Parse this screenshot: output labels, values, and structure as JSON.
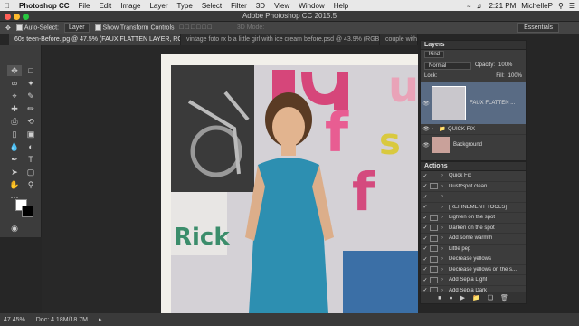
{
  "menubar": {
    "apple": "",
    "app_name": "Photoshop CC",
    "items": [
      "File",
      "Edit",
      "Image",
      "Layer",
      "Type",
      "Select",
      "Filter",
      "3D",
      "View",
      "Window",
      "Help"
    ],
    "time": "2:21 PM",
    "user": "MichelleP"
  },
  "window": {
    "title": "Adobe Photoshop CC 2015.5"
  },
  "options": {
    "auto_select_label": "Auto-Select:",
    "auto_select_value": "Layer",
    "transform_label": "Show Transform Controls",
    "mode_3d": "3D Mode:",
    "workspace": "Essentials"
  },
  "tabs": [
    {
      "label": "60s teen-Before.jpg @ 47.5% (FAUX FLATTEN LAYER, RGB/8#) *"
    },
    {
      "label": "vintage foto rx b a little girl with ice cream before.psd @ 43.9% (RGB/8)"
    },
    {
      "label": "couple with r..."
    }
  ],
  "status": {
    "zoom": "47.45%",
    "doc": "Doc: 4.18M/18.7M"
  },
  "layers_panel": {
    "title": "Layers",
    "kind_filter": "Kind",
    "blend_mode": "Normal",
    "opacity_label": "Opacity:",
    "opacity_value": "100%",
    "lock_label": "Lock:",
    "fill_label": "Fill:",
    "fill_value": "100%",
    "layers": [
      {
        "name": "FAUX FLATTEN ..."
      },
      {
        "name": "QUICK FIX"
      },
      {
        "name": "Background"
      }
    ]
  },
  "actions_panel": {
    "title": "Actions",
    "items": [
      {
        "label": "Quick Fix",
        "checked": true,
        "dialog": false
      },
      {
        "label": "Dust/Spot clean",
        "checked": true,
        "dialog": true
      },
      {
        "label": "",
        "checked": true,
        "dialog": false
      },
      {
        "label": "[REFINEMENT TOOLS]",
        "checked": true,
        "dialog": false
      },
      {
        "label": "Lighten on the spot",
        "checked": true,
        "dialog": true
      },
      {
        "label": "Darken on the spot",
        "checked": true,
        "dialog": true
      },
      {
        "label": "Add some warmth",
        "checked": true,
        "dialog": true
      },
      {
        "label": "Little pep",
        "checked": true,
        "dialog": true
      },
      {
        "label": "Decrease yellows",
        "checked": true,
        "dialog": true
      },
      {
        "label": "Decrease yellows on the s...",
        "checked": true,
        "dialog": true
      },
      {
        "label": "Add Sepia Light",
        "checked": true,
        "dialog": true
      },
      {
        "label": "Add Sepia Dark",
        "checked": true,
        "dialog": true
      }
    ]
  },
  "photo": {
    "wall_letters": [
      "u",
      "f",
      "s",
      "f",
      "Rick"
    ]
  }
}
